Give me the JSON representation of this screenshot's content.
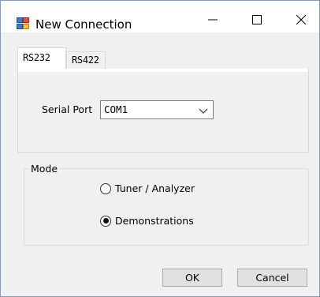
{
  "window": {
    "title": "New Connection",
    "app_icon": "network-app-icon",
    "controls": [
      "minimize-icon",
      "maximize-icon",
      "close-icon"
    ]
  },
  "tabs": [
    {
      "label": "RS232",
      "active": true
    },
    {
      "label": "RS422",
      "active": false
    }
  ],
  "serial": {
    "label": "Serial Port",
    "value": "COM1"
  },
  "mode": {
    "label": "Mode",
    "options": [
      {
        "label": "Tuner / Analyzer",
        "selected": false
      },
      {
        "label": "Demonstrations",
        "selected": true
      }
    ]
  },
  "buttons": {
    "ok": "OK",
    "cancel": "Cancel"
  }
}
